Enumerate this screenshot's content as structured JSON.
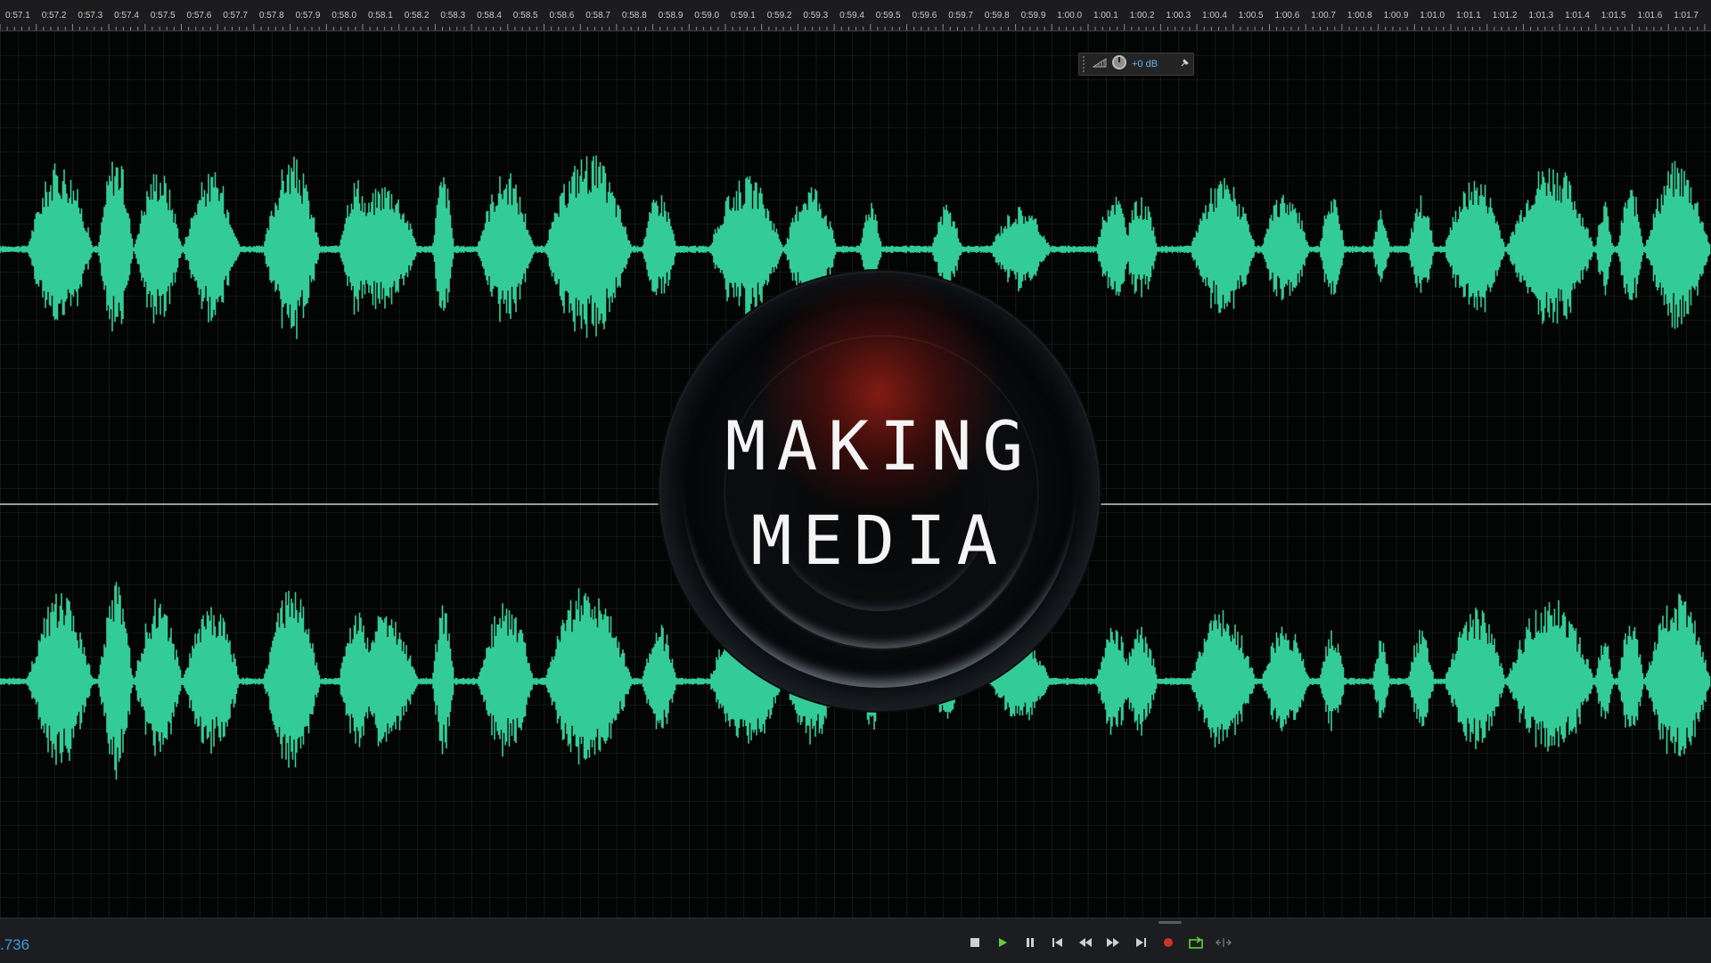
{
  "ruler": {
    "labels": [
      "0:57.1",
      "0:57.2",
      "0:57.3",
      "0:57.4",
      "0:57.5",
      "0:57.6",
      "0:57.7",
      "0:57.8",
      "0:57.9",
      "0:58.0",
      "0:58.1",
      "0:58.2",
      "0:58.3",
      "0:58.4",
      "0:58.5",
      "0:58.6",
      "0:58.7",
      "0:58.8",
      "0:58.9",
      "0:59.0",
      "0:59.1",
      "0:59.2",
      "0:59.3",
      "0:59.4",
      "0:59.5",
      "0:59.6",
      "0:59.7",
      "0:59.8",
      "0:59.9",
      "1:00.0",
      "1:00.1",
      "1:00.2",
      "1:00.3",
      "1:00.4",
      "1:00.5",
      "1:00.6",
      "1:00.7",
      "1:00.8",
      "1:00.9",
      "1:01.0",
      "1:01.1",
      "1:01.2",
      "1:01.3",
      "1:01.4",
      "1:01.5",
      "1:01.6",
      "1:01.7"
    ]
  },
  "hud": {
    "volume_label": "+0 dB",
    "icons": [
      "meter-icon",
      "volume-knob-icon",
      "pin-icon"
    ]
  },
  "logo": {
    "line1": "MAKING",
    "line2": "MEDIA"
  },
  "transport": {
    "timecode": ".736",
    "buttons": [
      "stop",
      "play",
      "pause",
      "go-to-start",
      "rewind",
      "fast-forward",
      "go-to-end",
      "record",
      "loop",
      "skip-selection"
    ]
  },
  "colors": {
    "waveform": "#33cc99",
    "background": "#030404",
    "timecode": "#3c9be0",
    "record": "#d03030",
    "play": "#5fcf3c"
  }
}
